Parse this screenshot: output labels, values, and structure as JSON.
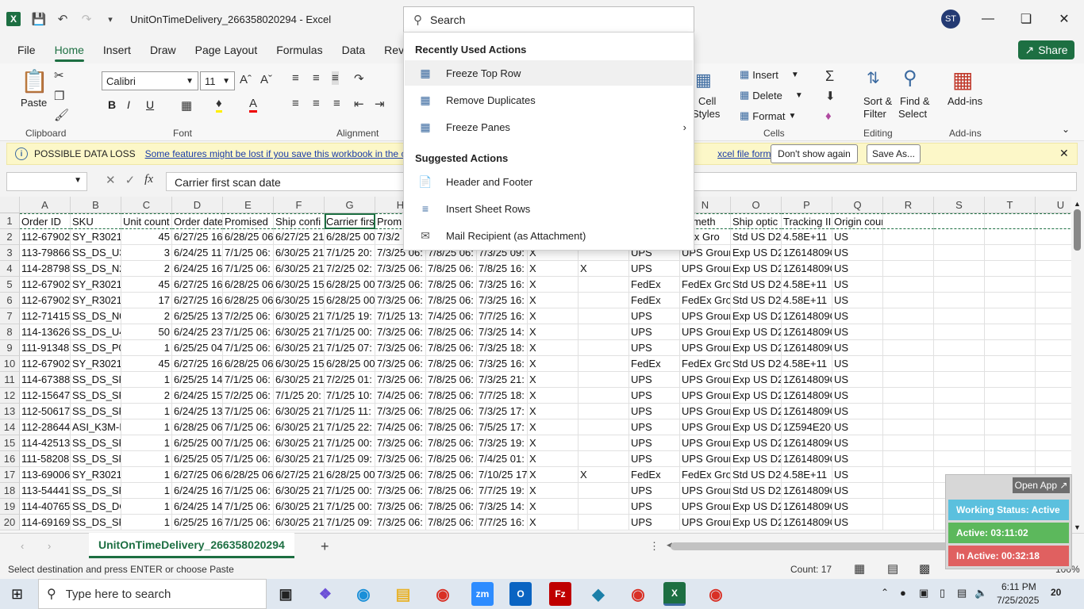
{
  "window": {
    "title": "UnitOnTimeDelivery_266358020294 - Excel",
    "avatar_initials": "ST",
    "share_label": "Share"
  },
  "search": {
    "placeholder": "Search",
    "recent_heading": "Recently Used Actions",
    "suggested_heading": "Suggested Actions",
    "recent": [
      "Freeze Top Row",
      "Remove Duplicates",
      "Freeze Panes"
    ],
    "suggested": [
      "Header and Footer",
      "Insert Sheet Rows",
      "Mail Recipient (as Attachment)"
    ]
  },
  "menu": [
    "File",
    "Home",
    "Insert",
    "Draw",
    "Page Layout",
    "Formulas",
    "Data",
    "Review",
    "V"
  ],
  "ribbon": {
    "paste": "Paste",
    "clipboard": "Clipboard",
    "font": "Font",
    "alignment": "Alignment",
    "font_name": "Calibri",
    "font_size": "11",
    "cell_styles_1": "Cell",
    "cell_styles_2": "Styles",
    "insert": "Insert",
    "delete": "Delete",
    "format": "Format",
    "cells": "Cells",
    "sort_1": "Sort &",
    "sort_2": "Filter",
    "find_1": "Find &",
    "find_2": "Select",
    "editing": "Editing",
    "addins": "Add-ins",
    "addins_group": "Add-ins",
    "bold": "B",
    "italic": "I",
    "underline": "U"
  },
  "warning": {
    "label": "POSSIBLE DATA LOSS",
    "message": "Some features might be lost if you save this workbook in the co",
    "message_end": "xcel file format.",
    "dont_show": "Don't show again",
    "save_as": "Save As..."
  },
  "formula": {
    "fx": "fx",
    "value": "Carrier first scan date"
  },
  "grid": {
    "columns": [
      "A",
      "B",
      "C",
      "D",
      "E",
      "F",
      "G",
      "H",
      "I",
      "J",
      "K",
      "L",
      "M",
      "N",
      "O",
      "P",
      "Q",
      "R",
      "S",
      "T",
      "U"
    ],
    "header_row": [
      "Order ID",
      "SKU",
      "Unit count",
      "Order date",
      "Promised",
      "Ship confi",
      "Carrier firs",
      "Prom",
      "",
      "",
      "",
      "",
      "",
      "ip meth",
      "Ship optic",
      "Tracking II",
      "Origin country",
      "",
      "",
      "",
      ""
    ],
    "rows": [
      [
        "112-67902",
        "SY_R3021C",
        "45",
        "6/27/25 16",
        "6/28/25 06",
        "6/27/25 21",
        "6/28/25 00",
        "7/3/2",
        "",
        "",
        "",
        "",
        "",
        "dEx Gro",
        "Std US D2I",
        "4.58E+11",
        "US"
      ],
      [
        "113-79866",
        "SS_DS_U3",
        "3",
        "6/24/25 11",
        "7/1/25 06:",
        "6/30/25 21",
        "7/1/25 20:",
        "7/3/25 06:",
        "7/8/25 06:",
        "7/3/25 09:",
        "X",
        "",
        "UPS",
        "UPS Grour",
        "Exp US D2",
        "1Z614809C",
        "US"
      ],
      [
        "114-28798",
        "SS_DS_N2",
        "2",
        "6/24/25 16",
        "7/1/25 06:",
        "6/30/25 21",
        "7/2/25 02:",
        "7/3/25 06:",
        "7/8/25 06:",
        "7/8/25 16:",
        "X",
        "X",
        "UPS",
        "UPS Grour",
        "Exp US D2",
        "1Z614809C",
        "US"
      ],
      [
        "112-67902",
        "SY_R3021C",
        "45",
        "6/27/25 16",
        "6/28/25 06",
        "6/30/25 15",
        "6/28/25 00",
        "7/3/25 06:",
        "7/8/25 06:",
        "7/3/25 16:",
        "X",
        "",
        "FedEx",
        "FedEx Gro",
        "Std US D2I",
        "4.58E+11",
        "US"
      ],
      [
        "112-67902",
        "SY_R3021C",
        "17",
        "6/27/25 16",
        "6/28/25 06",
        "6/30/25 15",
        "6/28/25 00",
        "7/3/25 06:",
        "7/8/25 06:",
        "7/3/25 16:",
        "X",
        "",
        "FedEx",
        "FedEx Gro",
        "Std US D2I",
        "4.58E+11",
        "US"
      ],
      [
        "112-71415",
        "SS_DS_N0",
        "2",
        "6/25/25 13",
        "7/2/25 06:",
        "6/30/25 21",
        "7/1/25 19:",
        "7/1/25 13:",
        "7/4/25 06:",
        "7/7/25 16:",
        "X",
        "",
        "UPS",
        "UPS Grour",
        "Exp US D2",
        "1Z614809C",
        "US"
      ],
      [
        "114-13626",
        "SS_DS_U4",
        "50",
        "6/24/25 23",
        "7/1/25 06:",
        "6/30/25 21",
        "7/1/25 00:",
        "7/3/25 06:",
        "7/8/25 06:",
        "7/3/25 14:",
        "X",
        "",
        "UPS",
        "UPS Grour",
        "Exp US D2",
        "1Z614809C",
        "US"
      ],
      [
        "111-91348",
        "SS_DS_P0",
        "1",
        "6/25/25 04",
        "7/1/25 06:",
        "6/30/25 21",
        "7/1/25 07:",
        "7/3/25 06:",
        "7/8/25 06:",
        "7/3/25 18:",
        "X",
        "",
        "UPS",
        "UPS Grour",
        "Exp US D2",
        "1Z614809C",
        "US"
      ],
      [
        "112-67902",
        "SY_R3021C",
        "45",
        "6/27/25 16",
        "6/28/25 06",
        "6/30/25 15",
        "6/28/25 00",
        "7/3/25 06:",
        "7/8/25 06:",
        "7/3/25 16:",
        "X",
        "",
        "FedEx",
        "FedEx Gro",
        "Std US D2I",
        "4.58E+11",
        "US"
      ],
      [
        "114-67388",
        "SS_DS_SP",
        "1",
        "6/25/25 14",
        "7/1/25 06:",
        "6/30/25 21",
        "7/2/25 01:",
        "7/3/25 06:",
        "7/8/25 06:",
        "7/3/25 21:",
        "X",
        "",
        "UPS",
        "UPS Grour",
        "Exp US D2",
        "1Z614809C",
        "US"
      ],
      [
        "112-15647",
        "SS_DS_SR",
        "2",
        "6/24/25 15",
        "7/2/25 06:",
        "7/1/25 20:",
        "7/1/25 10:",
        "7/4/25 06:",
        "7/8/25 06:",
        "7/7/25 18:",
        "X",
        "",
        "UPS",
        "UPS Grour",
        "Exp US D2",
        "1Z614809C",
        "US"
      ],
      [
        "112-50617",
        "SS_DS_SR",
        "1",
        "6/24/25 13",
        "7/1/25 06:",
        "6/30/25 21",
        "7/1/25 11:",
        "7/3/25 06:",
        "7/8/25 06:",
        "7/3/25 17:",
        "X",
        "",
        "UPS",
        "UPS Grour",
        "Exp US D2",
        "1Z614809C",
        "US"
      ],
      [
        "112-28644",
        "ASI_K3M-I",
        "1",
        "6/28/25 06",
        "7/1/25 06:",
        "6/30/25 21",
        "7/1/25 22:",
        "7/4/25 06:",
        "7/8/25 06:",
        "7/5/25 17:",
        "X",
        "",
        "UPS",
        "UPS Grour",
        "Exp US D2",
        "1Z594E20C",
        "US"
      ],
      [
        "114-42513",
        "SS_DS_SR",
        "1",
        "6/25/25 00",
        "7/1/25 06:",
        "6/30/25 21",
        "7/1/25 00:",
        "7/3/25 06:",
        "7/8/25 06:",
        "7/3/25 19:",
        "X",
        "",
        "UPS",
        "UPS Grour",
        "Exp US D2",
        "1Z614809C",
        "US"
      ],
      [
        "111-58208",
        "SS_DS_SP",
        "1",
        "6/25/25 05",
        "7/1/25 06:",
        "6/30/25 21",
        "7/1/25 09:",
        "7/3/25 06:",
        "7/8/25 06:",
        "7/4/25 01:",
        "X",
        "",
        "UPS",
        "UPS Grour",
        "Exp US D2",
        "1Z614809C",
        "US"
      ],
      [
        "113-69006",
        "SY_R3021C",
        "1",
        "6/27/25 06",
        "6/28/25 06",
        "6/27/25 21",
        "6/28/25 00",
        "7/3/25 06:",
        "7/8/25 06:",
        "7/10/25 17",
        "X",
        "X",
        "FedEx",
        "FedEx Gro",
        "Std US D2I",
        "4.58E+11",
        "US"
      ],
      [
        "113-54441",
        "SS_DS_SR",
        "1",
        "6/24/25 16",
        "7/1/25 06:",
        "6/30/25 21",
        "7/1/25 00:",
        "7/3/25 06:",
        "7/8/25 06:",
        "7/7/25 19:",
        "X",
        "",
        "UPS",
        "UPS Grour",
        "Std US D2I",
        "1Z614809C",
        "US"
      ],
      [
        "114-40765",
        "SS_DS_DC",
        "1",
        "6/24/25 14",
        "7/1/25 06:",
        "6/30/25 21",
        "7/1/25 00:",
        "7/3/25 06:",
        "7/8/25 06:",
        "7/3/25 14:",
        "X",
        "",
        "UPS",
        "UPS Grour",
        "Exp US D2",
        "1Z614809C",
        "US"
      ],
      [
        "114-69169",
        "SS_DS_SP",
        "1",
        "6/25/25 16",
        "7/1/25 06:",
        "6/30/25 21",
        "7/1/25 09:",
        "7/3/25 06:",
        "7/8/25 06:",
        "7/7/25 16:",
        "X",
        "",
        "UPS",
        "UPS Grour",
        "Exp US D2",
        "1Z614809C",
        "US"
      ]
    ]
  },
  "sheet": {
    "tab": "UnitOnTimeDelivery_266358020294",
    "add": "+"
  },
  "status": {
    "message": "Select destination and press ENTER or choose Paste",
    "count": "Count: 17",
    "zoom": "100%"
  },
  "tracker": {
    "open_app": "Open App ↗",
    "working": "Working Status: Active",
    "active": "Active: 03:11:02",
    "inactive": "In Active: 00:32:18"
  },
  "taskbar": {
    "search_placeholder": "Type here to search",
    "time": "6:11 PM",
    "date": "7/25/2025",
    "notifications": "20"
  },
  "colors": {
    "excel_green": "#1d6f42",
    "working_bar": "#5bc0de",
    "active_bar": "#5cb85c",
    "inactive_bar": "#e06060"
  }
}
